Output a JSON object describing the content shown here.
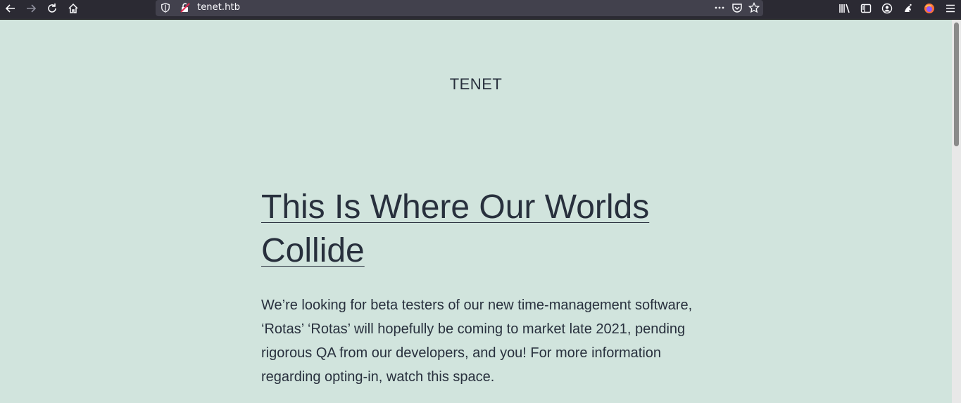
{
  "browser": {
    "url": "tenet.htb",
    "icons": [
      "back-icon",
      "forward-icon",
      "reload-icon",
      "home-icon",
      "shield-icon",
      "insecure-lock-icon",
      "more-icon",
      "pocket-icon",
      "star-icon",
      "library-icon",
      "sidebar-icon",
      "account-icon",
      "extension-icon",
      "firefox-icon",
      "menu-icon"
    ]
  },
  "site": {
    "title": "TENET"
  },
  "post": {
    "title_line1": "This Is Where Our Worlds",
    "title_line2": "Collide",
    "body": "We’re looking for beta testers of our new time-management software, ‘Rotas’ ‘Rotas’ will hopefully be coming to market late 2021, pending rigorous QA from our developers, and you! For more information regarding opting-in, watch this space."
  },
  "colors": {
    "page_background": "#d1e4dd",
    "text": "#28303d",
    "toolbar": "#2b2a33"
  }
}
